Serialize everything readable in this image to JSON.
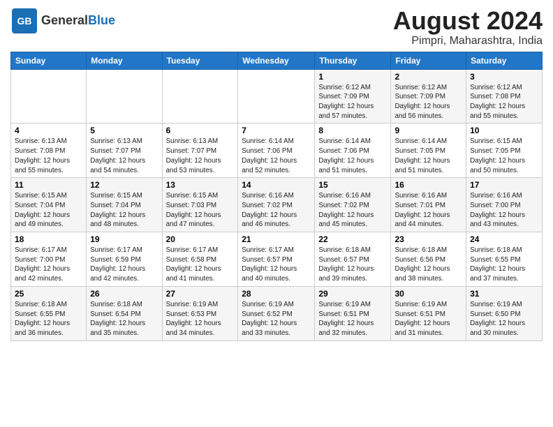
{
  "header": {
    "logo_general": "General",
    "logo_blue": "Blue",
    "title": "August 2024",
    "subtitle": "Pimpri, Maharashtra, India"
  },
  "calendar": {
    "days_of_week": [
      "Sunday",
      "Monday",
      "Tuesday",
      "Wednesday",
      "Thursday",
      "Friday",
      "Saturday"
    ],
    "weeks": [
      [
        {
          "day": "",
          "info": ""
        },
        {
          "day": "",
          "info": ""
        },
        {
          "day": "",
          "info": ""
        },
        {
          "day": "",
          "info": ""
        },
        {
          "day": "1",
          "info": "Sunrise: 6:12 AM\nSunset: 7:09 PM\nDaylight: 12 hours\nand 57 minutes."
        },
        {
          "day": "2",
          "info": "Sunrise: 6:12 AM\nSunset: 7:09 PM\nDaylight: 12 hours\nand 56 minutes."
        },
        {
          "day": "3",
          "info": "Sunrise: 6:12 AM\nSunset: 7:08 PM\nDaylight: 12 hours\nand 55 minutes."
        }
      ],
      [
        {
          "day": "4",
          "info": "Sunrise: 6:13 AM\nSunset: 7:08 PM\nDaylight: 12 hours\nand 55 minutes."
        },
        {
          "day": "5",
          "info": "Sunrise: 6:13 AM\nSunset: 7:07 PM\nDaylight: 12 hours\nand 54 minutes."
        },
        {
          "day": "6",
          "info": "Sunrise: 6:13 AM\nSunset: 7:07 PM\nDaylight: 12 hours\nand 53 minutes."
        },
        {
          "day": "7",
          "info": "Sunrise: 6:14 AM\nSunset: 7:06 PM\nDaylight: 12 hours\nand 52 minutes."
        },
        {
          "day": "8",
          "info": "Sunrise: 6:14 AM\nSunset: 7:06 PM\nDaylight: 12 hours\nand 51 minutes."
        },
        {
          "day": "9",
          "info": "Sunrise: 6:14 AM\nSunset: 7:05 PM\nDaylight: 12 hours\nand 51 minutes."
        },
        {
          "day": "10",
          "info": "Sunrise: 6:15 AM\nSunset: 7:05 PM\nDaylight: 12 hours\nand 50 minutes."
        }
      ],
      [
        {
          "day": "11",
          "info": "Sunrise: 6:15 AM\nSunset: 7:04 PM\nDaylight: 12 hours\nand 49 minutes."
        },
        {
          "day": "12",
          "info": "Sunrise: 6:15 AM\nSunset: 7:04 PM\nDaylight: 12 hours\nand 48 minutes."
        },
        {
          "day": "13",
          "info": "Sunrise: 6:15 AM\nSunset: 7:03 PM\nDaylight: 12 hours\nand 47 minutes."
        },
        {
          "day": "14",
          "info": "Sunrise: 6:16 AM\nSunset: 7:02 PM\nDaylight: 12 hours\nand 46 minutes."
        },
        {
          "day": "15",
          "info": "Sunrise: 6:16 AM\nSunset: 7:02 PM\nDaylight: 12 hours\nand 45 minutes."
        },
        {
          "day": "16",
          "info": "Sunrise: 6:16 AM\nSunset: 7:01 PM\nDaylight: 12 hours\nand 44 minutes."
        },
        {
          "day": "17",
          "info": "Sunrise: 6:16 AM\nSunset: 7:00 PM\nDaylight: 12 hours\nand 43 minutes."
        }
      ],
      [
        {
          "day": "18",
          "info": "Sunrise: 6:17 AM\nSunset: 7:00 PM\nDaylight: 12 hours\nand 42 minutes."
        },
        {
          "day": "19",
          "info": "Sunrise: 6:17 AM\nSunset: 6:59 PM\nDaylight: 12 hours\nand 42 minutes."
        },
        {
          "day": "20",
          "info": "Sunrise: 6:17 AM\nSunset: 6:58 PM\nDaylight: 12 hours\nand 41 minutes."
        },
        {
          "day": "21",
          "info": "Sunrise: 6:17 AM\nSunset: 6:57 PM\nDaylight: 12 hours\nand 40 minutes."
        },
        {
          "day": "22",
          "info": "Sunrise: 6:18 AM\nSunset: 6:57 PM\nDaylight: 12 hours\nand 39 minutes."
        },
        {
          "day": "23",
          "info": "Sunrise: 6:18 AM\nSunset: 6:56 PM\nDaylight: 12 hours\nand 38 minutes."
        },
        {
          "day": "24",
          "info": "Sunrise: 6:18 AM\nSunset: 6:55 PM\nDaylight: 12 hours\nand 37 minutes."
        }
      ],
      [
        {
          "day": "25",
          "info": "Sunrise: 6:18 AM\nSunset: 6:55 PM\nDaylight: 12 hours\nand 36 minutes."
        },
        {
          "day": "26",
          "info": "Sunrise: 6:18 AM\nSunset: 6:54 PM\nDaylight: 12 hours\nand 35 minutes."
        },
        {
          "day": "27",
          "info": "Sunrise: 6:19 AM\nSunset: 6:53 PM\nDaylight: 12 hours\nand 34 minutes."
        },
        {
          "day": "28",
          "info": "Sunrise: 6:19 AM\nSunset: 6:52 PM\nDaylight: 12 hours\nand 33 minutes."
        },
        {
          "day": "29",
          "info": "Sunrise: 6:19 AM\nSunset: 6:51 PM\nDaylight: 12 hours\nand 32 minutes."
        },
        {
          "day": "30",
          "info": "Sunrise: 6:19 AM\nSunset: 6:51 PM\nDaylight: 12 hours\nand 31 minutes."
        },
        {
          "day": "31",
          "info": "Sunrise: 6:19 AM\nSunset: 6:50 PM\nDaylight: 12 hours\nand 30 minutes."
        }
      ]
    ]
  }
}
